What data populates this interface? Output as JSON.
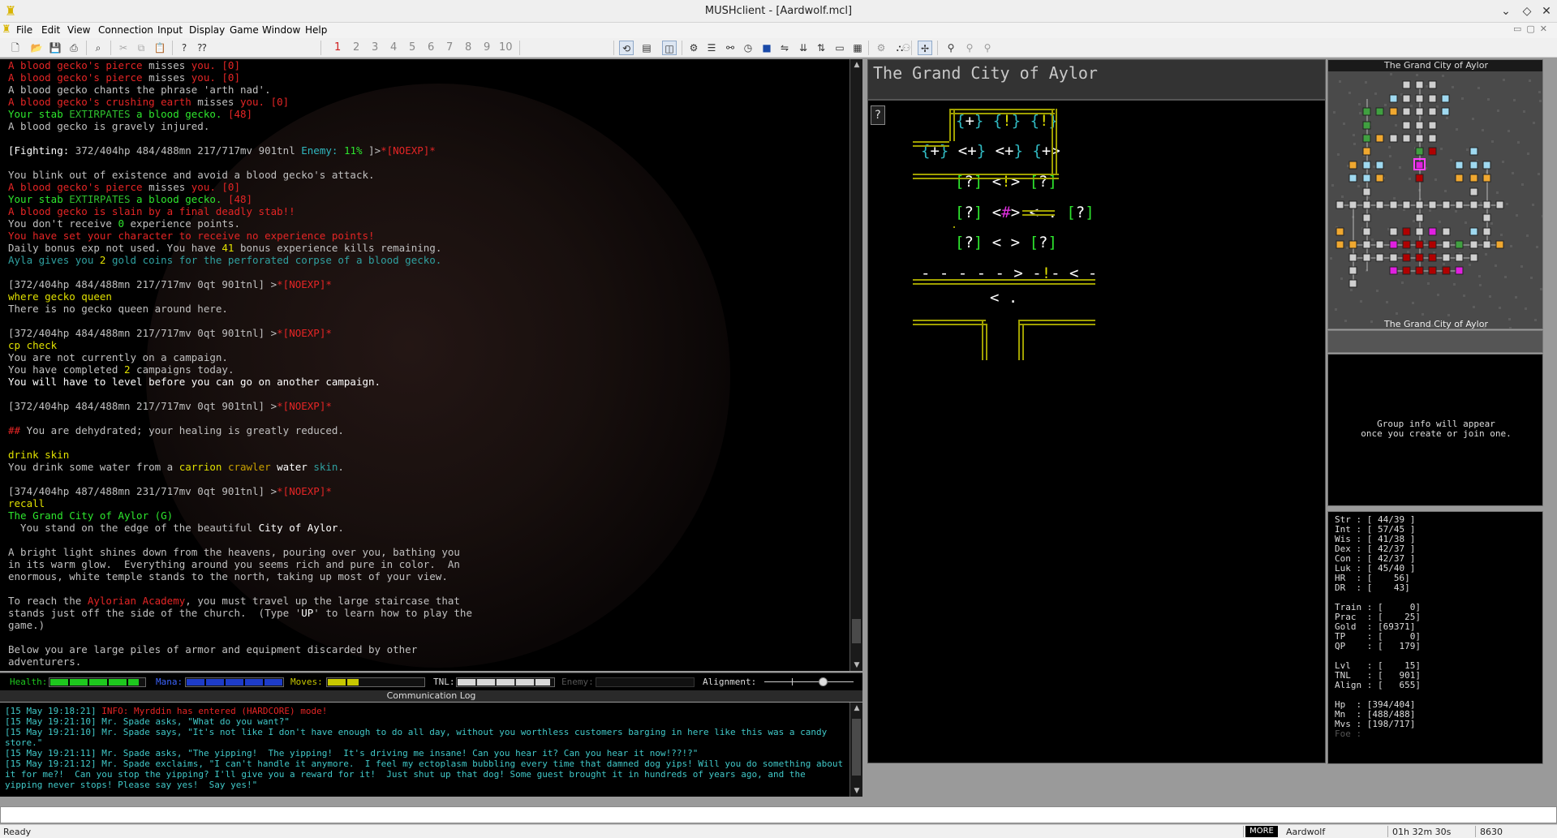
{
  "window": {
    "title": "MUSHclient - [Aardwolf.mcl]"
  },
  "menu": [
    "File",
    "Edit",
    "View",
    "Connection",
    "Input",
    "Display",
    "Game",
    "Window",
    "Help"
  ],
  "toolbar": {
    "world_numbers": [
      "1",
      "2",
      "3",
      "4",
      "5",
      "6",
      "7",
      "8",
      "9",
      "10"
    ]
  },
  "output": {
    "lines": [
      [
        {
          "t": "A blood gecko's pierce ",
          "c": "r"
        },
        {
          "t": "misses ",
          "c": "gr"
        },
        {
          "t": "you. [0]",
          "c": "r"
        }
      ],
      [
        {
          "t": "A blood gecko's pierce ",
          "c": "r"
        },
        {
          "t": "misses ",
          "c": "gr"
        },
        {
          "t": "you. [0]",
          "c": "r"
        }
      ],
      [
        {
          "t": "A blood gecko chants the phrase 'arth nad'.",
          "c": "gr"
        }
      ],
      [
        {
          "t": "A blood gecko's crushing earth ",
          "c": "r"
        },
        {
          "t": "misses ",
          "c": "gr"
        },
        {
          "t": "you. [0]",
          "c": "r"
        }
      ],
      [
        {
          "t": "Your stab ",
          "c": "g"
        },
        {
          "t": "EXTIRPATES",
          "c": "gg"
        },
        {
          "t": " a blood gecko. ",
          "c": "g"
        },
        {
          "t": "[48]",
          "c": "r"
        }
      ],
      [
        {
          "t": "A blood gecko is gravely injured.",
          "c": "gr"
        }
      ],
      [],
      [
        {
          "t": "[",
          "c": "w"
        },
        {
          "t": "Fighting: ",
          "c": "w"
        },
        {
          "t": "372/404hp 484/488mn 217/717mv 901tnl ",
          "c": "gr"
        },
        {
          "t": "Enemy: ",
          "c": "c"
        },
        {
          "t": "11%",
          "c": "g"
        },
        {
          "t": " ]>",
          "c": "gr"
        },
        {
          "t": "*[NOEXP]*",
          "c": "r"
        }
      ],
      [],
      [
        {
          "t": "You blink out of existence and avoid a blood gecko's attack.",
          "c": "gr"
        }
      ],
      [
        {
          "t": "A blood gecko's pierce ",
          "c": "r"
        },
        {
          "t": "misses ",
          "c": "gr"
        },
        {
          "t": "you. [0]",
          "c": "r"
        }
      ],
      [
        {
          "t": "Your stab ",
          "c": "g"
        },
        {
          "t": "EXTIRPATES",
          "c": "gg"
        },
        {
          "t": " a blood gecko. ",
          "c": "g"
        },
        {
          "t": "[48]",
          "c": "r"
        }
      ],
      [
        {
          "t": "A blood gecko is slain by a final deadly stab!!",
          "c": "r"
        }
      ],
      [
        {
          "t": "You don't receive ",
          "c": "gr"
        },
        {
          "t": "0",
          "c": "g"
        },
        {
          "t": " experience points.",
          "c": "gr"
        }
      ],
      [
        {
          "t": "You have set your character to receive no experience points!",
          "c": "r"
        }
      ],
      [
        {
          "t": "Daily bonus exp not used. You have ",
          "c": "gr"
        },
        {
          "t": "41",
          "c": "y"
        },
        {
          "t": " bonus experience kills remaining.",
          "c": "gr"
        }
      ],
      [
        {
          "t": "Ayla gives you ",
          "c": "lb"
        },
        {
          "t": "2",
          "c": "y"
        },
        {
          "t": " gold coins for the perforated corpse of a blood gecko.",
          "c": "lb"
        }
      ],
      [],
      [
        {
          "t": "[372/404hp 484/488mn 217/717mv 0qt 901tnl] >",
          "c": "gr"
        },
        {
          "t": "*[NOEXP]*",
          "c": "r"
        }
      ],
      [
        {
          "t": "where gecko queen",
          "c": "y"
        }
      ],
      [
        {
          "t": "There is no gecko queen around here.",
          "c": "gr"
        }
      ],
      [],
      [
        {
          "t": "[372/404hp 484/488mn 217/717mv 0qt 901tnl] >",
          "c": "gr"
        },
        {
          "t": "*[NOEXP]*",
          "c": "r"
        }
      ],
      [
        {
          "t": "cp check",
          "c": "y"
        }
      ],
      [
        {
          "t": "You are not currently on a campaign.",
          "c": "gr"
        }
      ],
      [
        {
          "t": "You have completed ",
          "c": "gr"
        },
        {
          "t": "2",
          "c": "y"
        },
        {
          "t": " campaigns today.",
          "c": "gr"
        }
      ],
      [
        {
          "t": "You will have to level before you can go on another campaign.",
          "c": "w"
        }
      ],
      [],
      [
        {
          "t": "[372/404hp 484/488mn 217/717mv 0qt 901tnl] >",
          "c": "gr"
        },
        {
          "t": "*[NOEXP]*",
          "c": "r"
        }
      ],
      [],
      [
        {
          "t": "## ",
          "c": "r"
        },
        {
          "t": "You are dehydrated; your healing is greatly reduced.",
          "c": "gr"
        }
      ],
      [],
      [
        {
          "t": "drink skin",
          "c": "y"
        }
      ],
      [
        {
          "t": "You drink some water from a ",
          "c": "gr"
        },
        {
          "t": "carrion ",
          "c": "y"
        },
        {
          "t": "crawler ",
          "c": "o"
        },
        {
          "t": "water ",
          "c": "w"
        },
        {
          "t": "skin",
          "c": "lb"
        },
        {
          "t": ".",
          "c": "gr"
        }
      ],
      [],
      [
        {
          "t": "[374/404hp 487/488mn 231/717mv 0qt 901tnl] >",
          "c": "gr"
        },
        {
          "t": "*[NOEXP]*",
          "c": "r"
        }
      ],
      [
        {
          "t": "recall",
          "c": "y"
        }
      ],
      [
        {
          "t": "The Grand City of Aylor (G)",
          "c": "g"
        }
      ],
      [
        {
          "t": "  You stand on the edge of the beautiful ",
          "c": "gr"
        },
        {
          "t": "City of Aylor",
          "c": "w"
        },
        {
          "t": ".",
          "c": "gr"
        }
      ],
      [],
      [
        {
          "t": "A bright light shines down from the heavens, pouring over you, bathing you",
          "c": "gr"
        }
      ],
      [
        {
          "t": "in its warm glow.  Everything around you seems rich and pure in color.  An",
          "c": "gr"
        }
      ],
      [
        {
          "t": "enormous, white temple stands to the north, taking up most of your view.",
          "c": "gr"
        }
      ],
      [],
      [
        {
          "t": "To reach the ",
          "c": "gr"
        },
        {
          "t": "Aylorian Academy",
          "c": "r"
        },
        {
          "t": ", you must travel up the large staircase that",
          "c": "gr"
        }
      ],
      [
        {
          "t": "stands just off the side of the church.  (Type '",
          "c": "gr"
        },
        {
          "t": "UP",
          "c": "w"
        },
        {
          "t": "' to learn how to play the",
          "c": "gr"
        }
      ],
      [
        {
          "t": "game.)",
          "c": "gr"
        }
      ],
      [],
      [
        {
          "t": "Below you are large piles of armor and equipment discarded by other",
          "c": "gr"
        }
      ],
      [
        {
          "t": "adventurers.",
          "c": "gr"
        }
      ]
    ]
  },
  "gauges": {
    "health_label": "Health:",
    "mana_label": "Mana:",
    "moves_label": "Moves:",
    "tnl_label": "TNL:",
    "enemy_label": "Enemy:",
    "alignment_label": "Alignment:",
    "health_pct": 92,
    "mana_pct": 99,
    "moves_pct": 32,
    "tnl_pct": 95,
    "enemy_pct": 0,
    "alignment_pct": 66,
    "colors": {
      "health": "#1ec81e",
      "mana": "#1e3cc8",
      "moves": "#c8c800",
      "tnl": "#d8d8d8"
    }
  },
  "comm": {
    "title": "Communication Log",
    "lines": [
      [
        {
          "t": "[15 May 19:18:21] ",
          "c": "cy"
        },
        {
          "t": "INFO: Myrddin has entered (HARDCORE) mode!",
          "c": "r"
        }
      ],
      [
        {
          "t": "[15 May 19:21:10] ",
          "c": "cy"
        },
        {
          "t": "Mr. Spade asks, \"What do you want?\"",
          "c": "cy"
        }
      ],
      [
        {
          "t": "[15 May 19:21:10] ",
          "c": "cy"
        },
        {
          "t": "Mr. Spade says, \"It's not like I don't have enough to do all day, without you worthless customers barging in here like this was a candy store.\"",
          "c": "cy"
        }
      ],
      [
        {
          "t": "[15 May 19:21:11] ",
          "c": "cy"
        },
        {
          "t": "Mr. Spade asks, \"The yipping!  The yipping!  It's driving me insane! Can you hear it? Can you hear it now!??!?\"",
          "c": "cy"
        }
      ],
      [
        {
          "t": "[15 May 19:21:12] ",
          "c": "cy"
        },
        {
          "t": "Mr. Spade exclaims, \"I can't handle it anymore.  I feel my ectoplasm bubbling every time that damned dog yips! Will you do something about it for me?!  Can you stop the yipping? I'll give you a reward for it!  Just shut up that dog! Some guest brought it in hundreds of years ago, and the yipping never stops! Please say yes!  Say yes!\"",
          "c": "cy"
        }
      ]
    ]
  },
  "map": {
    "area_title": "The Grand City of Aylor",
    "help_glyph": "?",
    "rows": [
      [
        {
          "t": "{",
          "c": "c"
        },
        {
          "t": "+",
          "c": "w"
        },
        {
          "t": "} ",
          "c": "c"
        },
        {
          "t": "{",
          "c": "c"
        },
        {
          "t": "!",
          "c": "y"
        },
        {
          "t": "} ",
          "c": "c"
        },
        {
          "t": "{",
          "c": "c"
        },
        {
          "t": "!",
          "c": "y"
        },
        {
          "t": "}",
          "c": "c"
        }
      ],
      [
        {
          "t": "{",
          "c": "c"
        },
        {
          "t": "+",
          "c": "w"
        },
        {
          "t": "} ",
          "c": "c"
        },
        {
          "t": "<",
          "c": "w"
        },
        {
          "t": "+",
          "c": "w"
        },
        {
          "t": "} ",
          "c": "c"
        },
        {
          "t": "<",
          "c": "w"
        },
        {
          "t": "+",
          "c": "w"
        },
        {
          "t": "} ",
          "c": "c"
        },
        {
          "t": "{",
          "c": "c"
        },
        {
          "t": "+",
          "c": "w"
        },
        {
          "t": ">",
          "c": "w"
        }
      ],
      [
        {
          "t": "[",
          "c": "g"
        },
        {
          "t": "?",
          "c": "w"
        },
        {
          "t": "] ",
          "c": "g"
        },
        {
          "t": "<",
          "c": "w"
        },
        {
          "t": "!",
          "c": "y"
        },
        {
          "t": "> ",
          "c": "w"
        },
        {
          "t": "[",
          "c": "g"
        },
        {
          "t": "?",
          "c": "w"
        },
        {
          "t": "]",
          "c": "g"
        }
      ],
      [
        {
          "t": "[",
          "c": "g"
        },
        {
          "t": "?",
          "c": "w"
        },
        {
          "t": "] ",
          "c": "g"
        },
        {
          "t": "<",
          "c": "w"
        },
        {
          "t": "#",
          "c": "mg"
        },
        {
          "t": "> < . ",
          "c": "w"
        },
        {
          "t": "[",
          "c": "g"
        },
        {
          "t": "?",
          "c": "w"
        },
        {
          "t": "]",
          "c": "g"
        }
      ],
      [
        {
          "t": "[",
          "c": "g"
        },
        {
          "t": "?",
          "c": "w"
        },
        {
          "t": "] ",
          "c": "g"
        },
        {
          "t": "< > ",
          "c": "w"
        },
        {
          "t": "[",
          "c": "g"
        },
        {
          "t": "?",
          "c": "w"
        },
        {
          "t": "]",
          "c": "g"
        }
      ],
      [
        {
          "t": "- - - - - > -",
          "c": "w"
        },
        {
          "t": "!",
          "c": "y"
        },
        {
          "t": "- < -",
          "c": "w"
        }
      ],
      [
        {
          "t": "< .",
          "c": "w"
        }
      ]
    ]
  },
  "minimap": {
    "title": "The Grand City of Aylor",
    "bottom_label": "The Grand City of Aylor"
  },
  "group": {
    "line1": "Group info will appear",
    "line2": "once you create or join one."
  },
  "stats": {
    "block1": [
      "Str : [ 44/39 ]",
      "Int : [ 57/45 ]",
      "Wis : [ 41/38 ]",
      "Dex : [ 42/37 ]",
      "Con : [ 42/37 ]",
      "Luk : [ 45/40 ]",
      "HR  : [    56]",
      "DR  : [    43]"
    ],
    "block2": [
      "Train : [     0]",
      "Prac  : [    25]",
      "Gold  : [69371]",
      "TP    : [     0]",
      "QP    : [   179]"
    ],
    "block3": [
      "Lvl   : [    15]",
      "TNL   : [   901]",
      "Align : [   655]"
    ],
    "block4": [
      "Hp  : [394/404]",
      "Mn  : [488/488]",
      "Mvs : [198/717]",
      "Foe :"
    ]
  },
  "statusbar": {
    "ready": "Ready",
    "more": "MORE",
    "world": "Aardwolf",
    "time": "01h 32m 30s",
    "lines": "8630"
  }
}
